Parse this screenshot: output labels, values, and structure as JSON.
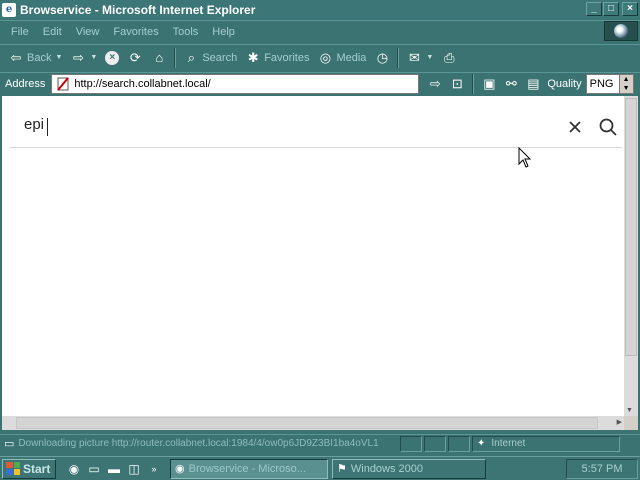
{
  "window": {
    "title": "Browservice - Microsoft Internet Explorer",
    "controls": {
      "minimize": "_",
      "maximize": "□",
      "close": "×"
    }
  },
  "menu": {
    "items": [
      "File",
      "Edit",
      "View",
      "Favorites",
      "Tools",
      "Help"
    ]
  },
  "toolbar": {
    "back_label": "Back",
    "search_label": "Search",
    "favorites_label": "Favorites",
    "media_label": "Media"
  },
  "address": {
    "label": "Address",
    "url": "http://search.collabnet.local/",
    "quality_label": "Quality",
    "quality_value": "PNG"
  },
  "page": {
    "search_value": "epi"
  },
  "status": {
    "text": "Downloading picture http://router.collabnet.local:1984/4/ow0p6JD9Z3BI1ba4oVL1",
    "zone": "Internet"
  },
  "taskbar": {
    "start_label": "Start",
    "tasks": [
      "Browservice - Microso...",
      "Windows 2000"
    ],
    "clock": "5:57 PM"
  },
  "colors": {
    "chrome": "#3b7373",
    "menu_text": "#a4cfcf",
    "content_bg": "#ffffff"
  }
}
